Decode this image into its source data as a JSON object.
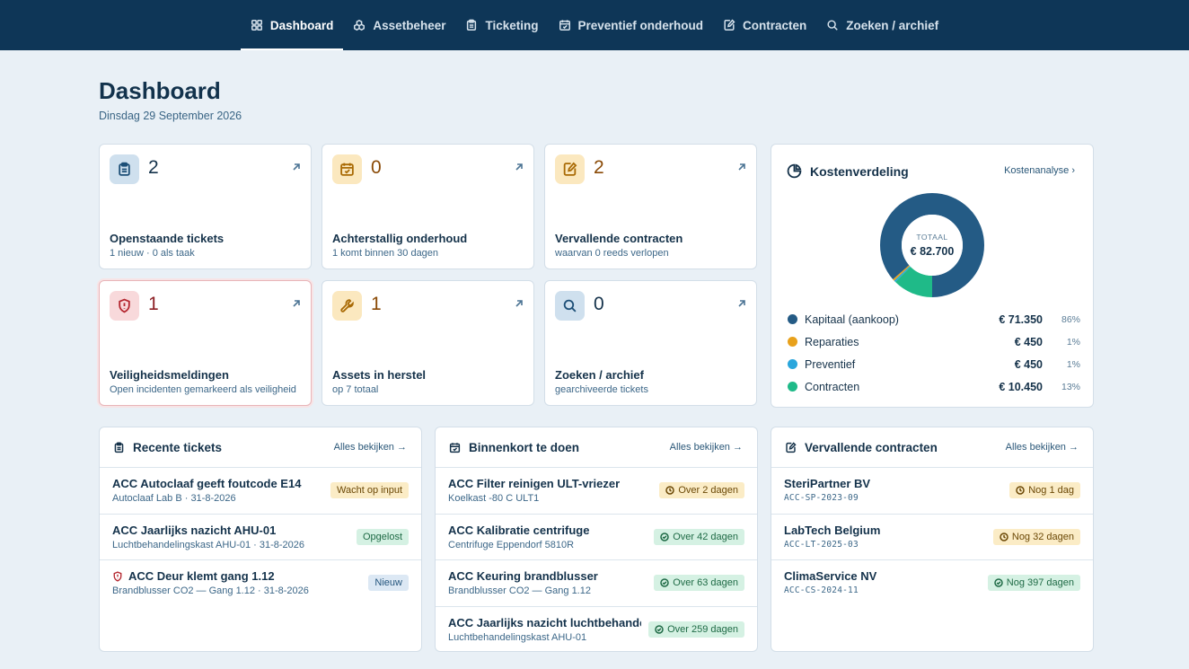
{
  "nav": {
    "items": [
      {
        "label": "Dashboard",
        "icon": "grid-icon",
        "active": true
      },
      {
        "label": "Assetbeheer",
        "icon": "boxes-icon",
        "active": false
      },
      {
        "label": "Ticketing",
        "icon": "clipboard-icon",
        "active": false
      },
      {
        "label": "Preventief onderhoud",
        "icon": "calendar-check-icon",
        "active": false
      },
      {
        "label": "Contracten",
        "icon": "file-pen-icon",
        "active": false
      },
      {
        "label": "Zoeken / archief",
        "icon": "search-icon",
        "active": false
      }
    ]
  },
  "header": {
    "title": "Dashboard",
    "date": "Dinsdag 29 September 2026"
  },
  "stats": [
    {
      "value": "2",
      "label": "Openstaande tickets",
      "sub": "1 nieuw · 0 als taak",
      "icon": "clipboard-icon",
      "tone": "blue"
    },
    {
      "value": "0",
      "label": "Achterstallig onderhoud",
      "sub": "1 komt binnen 30 dagen",
      "icon": "calendar-check-icon",
      "tone": "amber"
    },
    {
      "value": "2",
      "label": "Vervallende contracten",
      "sub": "waarvan 0 reeds verlopen",
      "icon": "file-pen-icon",
      "tone": "amber"
    },
    {
      "value": "1",
      "label": "Veiligheidsmeldingen",
      "sub": "Open incidenten gemarkeerd als veiligheid",
      "icon": "shield-alert-icon",
      "tone": "red"
    },
    {
      "value": "1",
      "label": "Assets in herstel",
      "sub": "op 7 totaal",
      "icon": "wrench-icon",
      "tone": "amber"
    },
    {
      "value": "0",
      "label": "Zoeken / archief",
      "sub": "gearchiveerde tickets",
      "icon": "search-icon",
      "tone": "blue"
    }
  ],
  "kosten": {
    "title": "Kostenverdeling",
    "link": "Kostenanalyse",
    "total_caption": "TOTAAL",
    "total_value": "€ 82.700",
    "items": [
      {
        "label": "Kapitaal (aankoop)",
        "value": "€ 71.350",
        "pct": "86%",
        "share": 71350,
        "color": "#245b85"
      },
      {
        "label": "Reparaties",
        "value": "€ 450",
        "pct": "1%",
        "share": 450,
        "color": "#e8a11b"
      },
      {
        "label": "Preventief",
        "value": "€ 450",
        "pct": "1%",
        "share": 450,
        "color": "#2aa6dc"
      },
      {
        "label": "Contracten",
        "value": "€ 10.450",
        "pct": "13%",
        "share": 10450,
        "color": "#1fba88"
      }
    ]
  },
  "recent": {
    "title": "Recente tickets",
    "link": "Alles bekijken",
    "rows": [
      {
        "title": "ACC Autoclaaf geeft foutcode E14",
        "sub": "Autoclaaf Lab B · 31-8-2026",
        "badge": "Wacht op input",
        "tone": "amber",
        "safety": false
      },
      {
        "title": "ACC Jaarlijks nazicht AHU-01",
        "sub": "Luchtbehandelingskast AHU-01 · 31-8-2026",
        "badge": "Opgelost",
        "tone": "green",
        "safety": false
      },
      {
        "title": "ACC Deur klemt gang 1.12",
        "sub": "Brandblusser CO2 — Gang 1.12 · 31-8-2026",
        "badge": "Nieuw",
        "tone": "blue",
        "safety": true
      }
    ]
  },
  "todo": {
    "title": "Binnenkort te doen",
    "link": "Alles bekijken",
    "rows": [
      {
        "title": "ACC Filter reinigen ULT-vriezer",
        "sub": "Koelkast -80 C ULT1",
        "badge": "Over 2 dagen",
        "tone": "amber"
      },
      {
        "title": "ACC Kalibratie centrifuge",
        "sub": "Centrifuge Eppendorf 5810R",
        "badge": "Over 42 dagen",
        "tone": "green"
      },
      {
        "title": "ACC Keuring brandblusser",
        "sub": "Brandblusser CO2 — Gang 1.12",
        "badge": "Over 63 dagen",
        "tone": "green"
      },
      {
        "title": "ACC Jaarlijks nazicht luchtbehandel...",
        "sub": "Luchtbehandelingskast AHU-01",
        "badge": "Over 259 dagen",
        "tone": "green"
      }
    ]
  },
  "contracts": {
    "title": "Vervallende contracten",
    "link": "Alles bekijken",
    "rows": [
      {
        "title": "SteriPartner BV",
        "sub": "ACC-SP-2023-09",
        "badge": "Nog 1 dag",
        "tone": "amber"
      },
      {
        "title": "LabTech Belgium",
        "sub": "ACC-LT-2025-03",
        "badge": "Nog 32 dagen",
        "tone": "amber"
      },
      {
        "title": "ClimaService NV",
        "sub": "ACC-CS-2024-11",
        "badge": "Nog 397 dagen",
        "tone": "green"
      }
    ]
  }
}
